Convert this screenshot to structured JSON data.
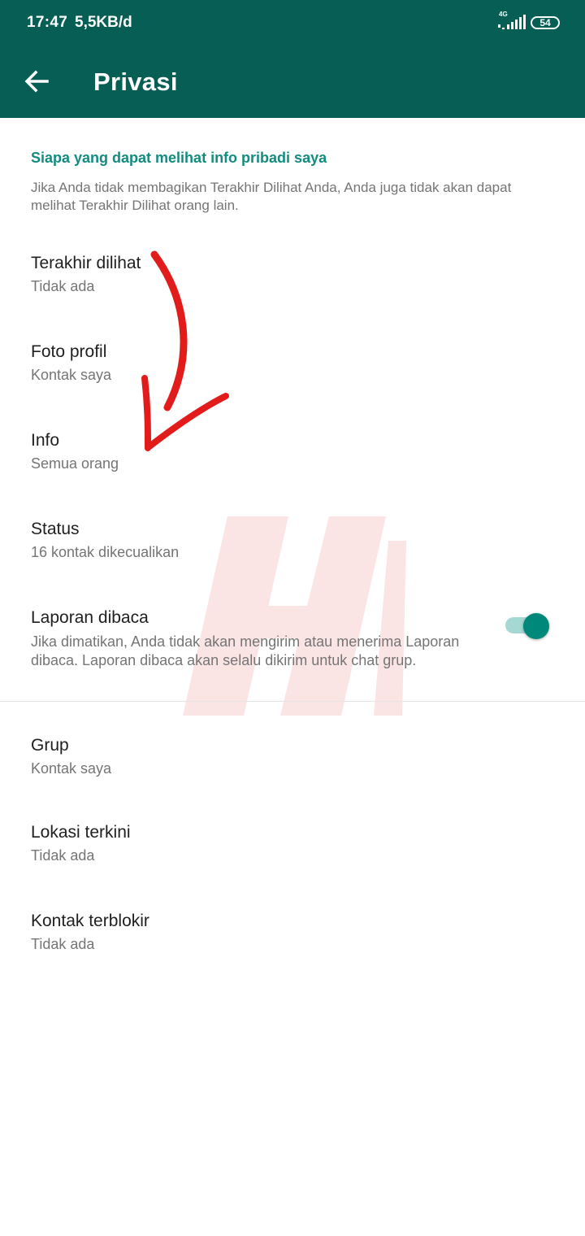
{
  "status_bar": {
    "time": "17:47",
    "speed": "5,5KB/d",
    "network": "4G",
    "battery": "54"
  },
  "app_bar": {
    "title": "Privasi",
    "back_icon": "arrow-left-icon"
  },
  "section": {
    "title": "Siapa yang dapat melihat info pribadi saya",
    "description": "Jika Anda tidak membagikan Terakhir Dilihat Anda, Anda juga tidak akan dapat melihat Terakhir Dilihat orang lain."
  },
  "items": [
    {
      "label": "Terakhir dilihat",
      "value": "Tidak ada"
    },
    {
      "label": "Foto profil",
      "value": "Kontak saya"
    },
    {
      "label": "Info",
      "value": "Semua orang"
    },
    {
      "label": "Status",
      "value": "16 kontak dikecualikan"
    },
    {
      "label": "Laporan dibaca",
      "value": "Jika dimatikan, Anda tidak akan mengirim atau menerima Laporan dibaca. Laporan dibaca akan selalu dikirim untuk chat grup.",
      "toggle_on": true
    },
    {
      "label": "Grup",
      "value": "Kontak saya"
    },
    {
      "label": "Lokasi terkini",
      "value": "Tidak ada"
    },
    {
      "label": "Kontak terblokir",
      "value": "Tidak ada"
    }
  ],
  "colors": {
    "header": "#075e54",
    "accent": "#128c7e",
    "toggle_thumb": "#00897b",
    "toggle_track": "#a5d8d2",
    "annotation_arrow": "#e21b1b"
  }
}
